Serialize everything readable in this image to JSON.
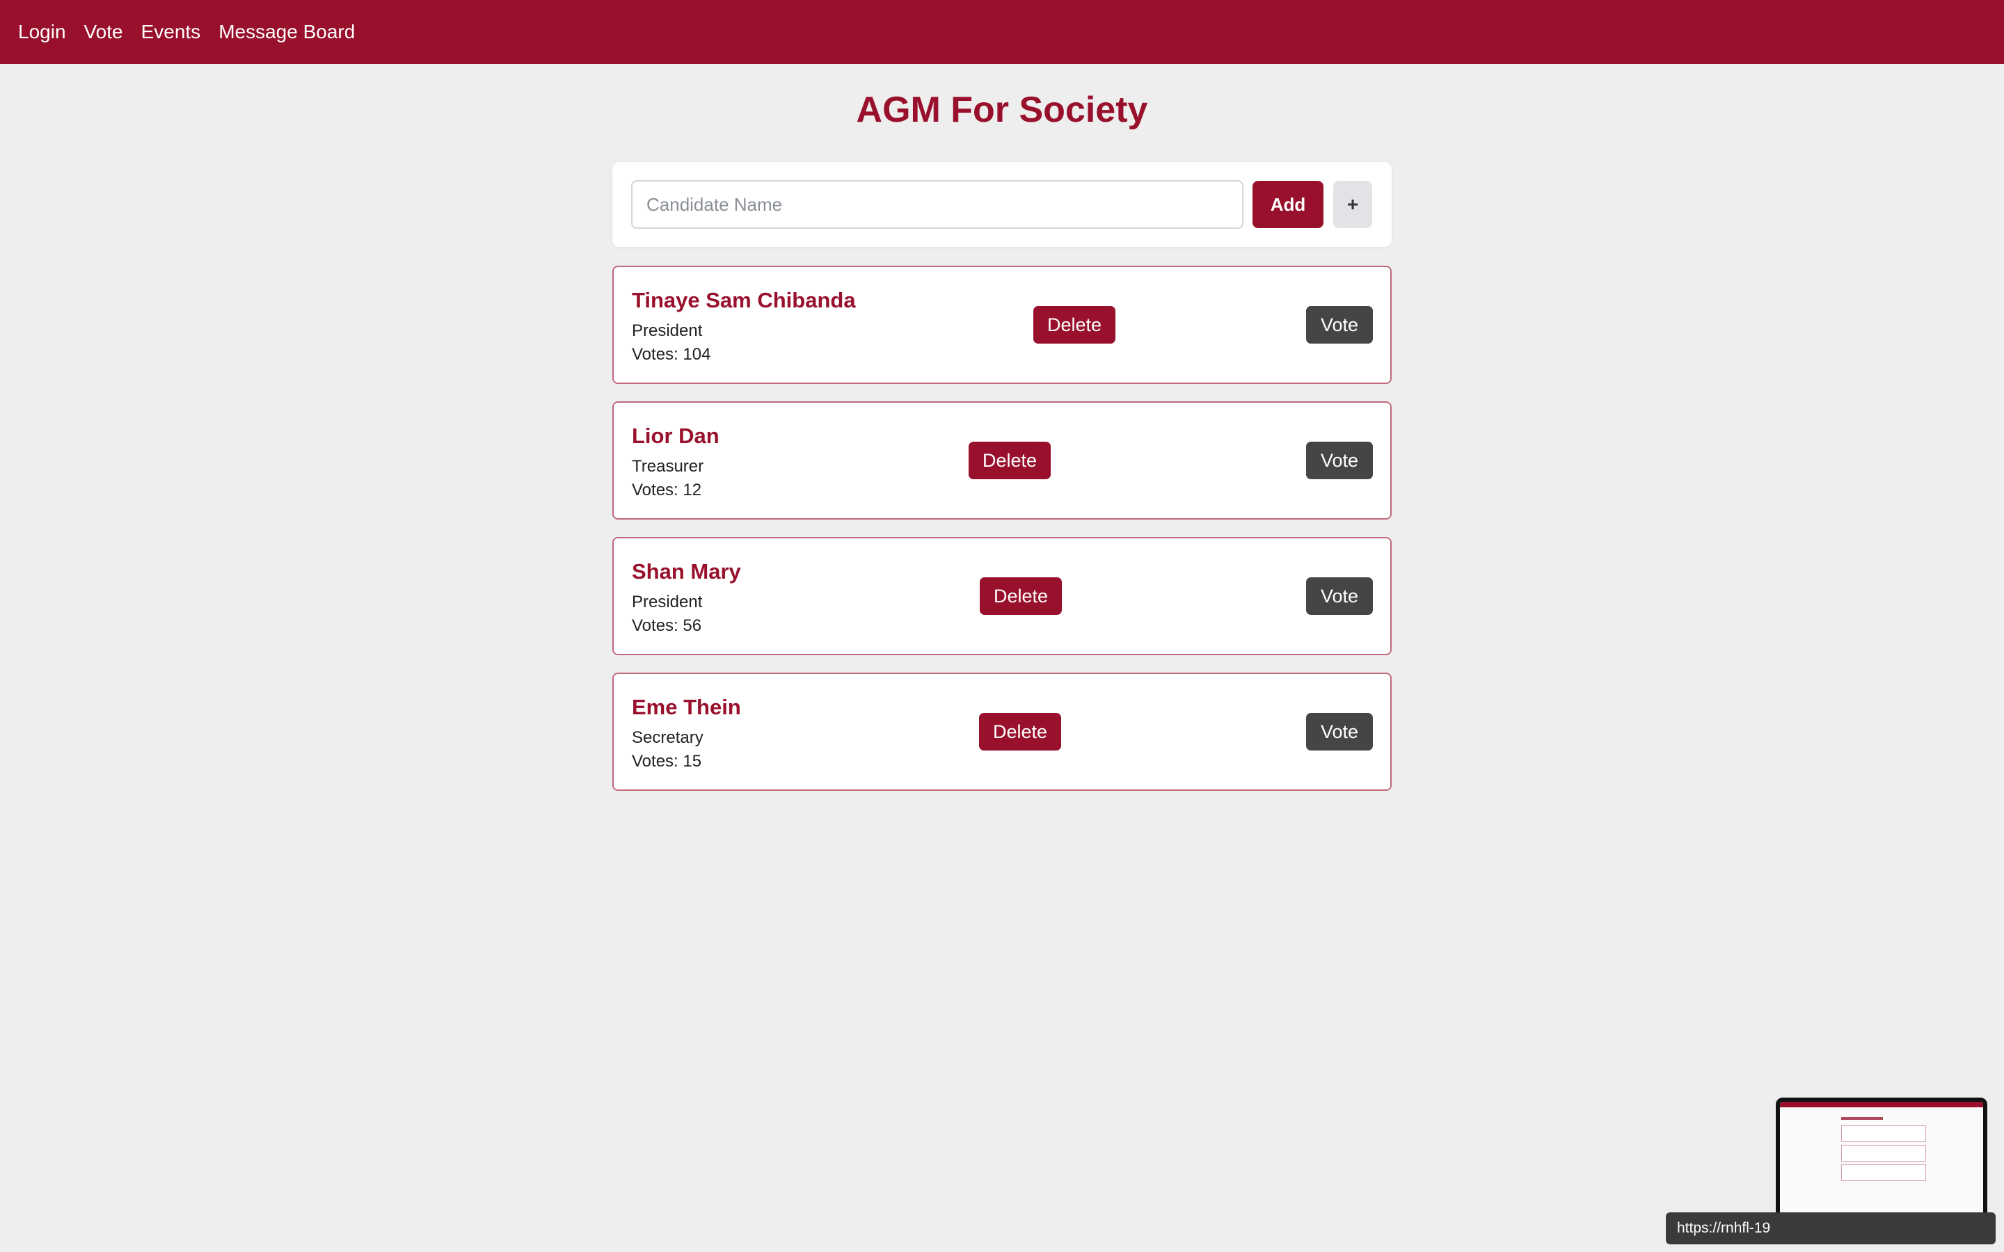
{
  "nav": {
    "items": [
      {
        "label": "Login"
      },
      {
        "label": "Vote"
      },
      {
        "label": "Events"
      },
      {
        "label": "Message Board"
      }
    ]
  },
  "page": {
    "title": "AGM For Society"
  },
  "add_form": {
    "placeholder": "Candidate Name",
    "value": "",
    "add_label": "Add",
    "plus_label": "+"
  },
  "candidates": [
    {
      "name": "Tinaye Sam Chibanda",
      "role": "President",
      "votes_text": "Votes: 104",
      "votes": 104,
      "delete_label": "Delete",
      "vote_label": "Vote"
    },
    {
      "name": "Lior Dan",
      "role": "Treasurer",
      "votes_text": "Votes: 12",
      "votes": 12,
      "delete_label": "Delete",
      "vote_label": "Vote"
    },
    {
      "name": "Shan Mary",
      "role": "President",
      "votes_text": "Votes: 56",
      "votes": 56,
      "delete_label": "Delete",
      "vote_label": "Vote"
    },
    {
      "name": "Eme Thein",
      "role": "Secretary",
      "votes_text": "Votes: 15",
      "votes": 15,
      "delete_label": "Delete",
      "vote_label": "Vote"
    }
  ],
  "status_bar": {
    "url_text": "https://rnhfl-19"
  },
  "colors": {
    "brand": "#98102b",
    "vote_button": "#454545",
    "background": "#eeeeee"
  }
}
